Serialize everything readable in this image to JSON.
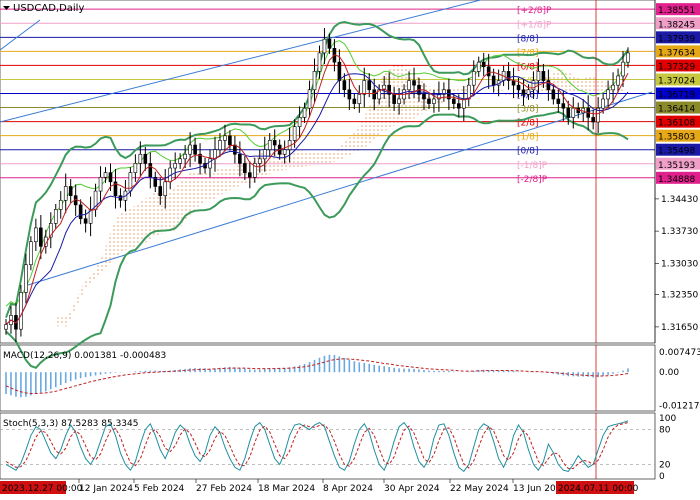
{
  "chart_data": {
    "type": "candlestick",
    "title": "USDCAD,Daily",
    "price_axis": {
      "ticks": [
        "1.34430",
        "1.33730",
        "1.33030",
        "1.32350",
        "1.31650"
      ],
      "ylim": [
        1.313,
        1.3875
      ]
    },
    "date_axis": {
      "ticks": [
        "12 Jan 2024",
        "5 Feb 2024",
        "27 Feb 2024",
        "18 Mar 2024",
        "8 Apr 2024",
        "30 Apr 2024",
        "22 May 2024",
        "13 Jun 20"
      ],
      "start_label": "2023.12.27 00:00",
      "cursor_label": "2024.07.11 00:00"
    },
    "price_levels": [
      {
        "price": "1.38551",
        "value": 1.38551,
        "label": "[+2/8]P",
        "color": "#e0208c"
      },
      {
        "price": "1.38245",
        "value": 1.38245,
        "label": "[+1/8]P",
        "color": "#f0a0c8"
      },
      {
        "price": "1.37939",
        "value": 1.37939,
        "label": "[8/8]",
        "color": "#1a1aa6"
      },
      {
        "price": "1.37634",
        "value": 1.37634,
        "label": "[7/8]",
        "color": "#e6a817"
      },
      {
        "price": "1.37329",
        "value": 1.37329,
        "label": "[6/8]",
        "color": "#e00000"
      },
      {
        "price": "1.37024",
        "value": 1.37024,
        "label": "[5/8]",
        "color": "#c8c840"
      },
      {
        "price": "1.36719",
        "value": 1.36719,
        "label": "[4/8]",
        "color": "#0000c8"
      },
      {
        "price": "1.36414",
        "value": 1.36414,
        "label": "[3/8]",
        "color": "#8a8a2a"
      },
      {
        "price": "1.36108",
        "value": 1.36108,
        "label": "[2/8]",
        "color": "#e00000"
      },
      {
        "price": "1.35803",
        "value": 1.35803,
        "label": "[1/8]",
        "color": "#e6a817"
      },
      {
        "price": "1.35498",
        "value": 1.35498,
        "label": "[0/8]",
        "color": "#1a1aa6"
      },
      {
        "price": "1.35193",
        "value": 1.35193,
        "label": "[-1/8]P",
        "color": "#f0a0c8"
      },
      {
        "price": "1.34888",
        "value": 1.34888,
        "label": "[-2/8]P",
        "color": "#e0208c"
      }
    ],
    "close": [
      1.317,
      1.319,
      1.316,
      1.324,
      1.33,
      1.335,
      1.338,
      1.334,
      1.336,
      1.339,
      1.342,
      1.344,
      1.347,
      1.345,
      1.343,
      1.34,
      1.339,
      1.342,
      1.346,
      1.349,
      1.35,
      1.348,
      1.345,
      1.344,
      1.346,
      1.35,
      1.352,
      1.354,
      1.352,
      1.349,
      1.347,
      1.345,
      1.348,
      1.351,
      1.352,
      1.353,
      1.354,
      1.356,
      1.354,
      1.352,
      1.351,
      1.353,
      1.355,
      1.357,
      1.358,
      1.356,
      1.354,
      1.352,
      1.35,
      1.349,
      1.352,
      1.353,
      1.355,
      1.357,
      1.356,
      1.354,
      1.355,
      1.357,
      1.36,
      1.362,
      1.364,
      1.368,
      1.372,
      1.376,
      1.379,
      1.377,
      1.374,
      1.37,
      1.368,
      1.366,
      1.365,
      1.367,
      1.37,
      1.368,
      1.366,
      1.368,
      1.369,
      1.367,
      1.365,
      1.366,
      1.368,
      1.37,
      1.369,
      1.367,
      1.366,
      1.365,
      1.366,
      1.367,
      1.368,
      1.366,
      1.365,
      1.364,
      1.366,
      1.369,
      1.372,
      1.374,
      1.373,
      1.371,
      1.369,
      1.37,
      1.372,
      1.37,
      1.369,
      1.368,
      1.367,
      1.368,
      1.37,
      1.372,
      1.37,
      1.368,
      1.366,
      1.365,
      1.364,
      1.362,
      1.364,
      1.363,
      1.364,
      1.362,
      1.361,
      1.364,
      1.366,
      1.368,
      1.369,
      1.371,
      1.374,
      1.376
    ],
    "indicators": {
      "macd": {
        "label": "MACD(12,26,9) 0.001381 -0.000483",
        "ticks": [
          "0.007473",
          "0.00",
          "-0.012179"
        ],
        "ylim": [
          -0.0135,
          0.0085
        ],
        "histogram": [
          -0.008,
          -0.0085,
          -0.009,
          -0.0092,
          -0.009,
          -0.0085,
          -0.008,
          -0.0075,
          -0.007,
          -0.0063,
          -0.0055,
          -0.0047,
          -0.004,
          -0.0033,
          -0.0027,
          -0.0022,
          -0.0018,
          -0.0015,
          -0.0012,
          -0.0009,
          -0.0006,
          -0.0004,
          -0.0002,
          -0.0001,
          0.0,
          0.0001,
          0.0003,
          0.0004,
          0.0005,
          0.0006,
          0.0006,
          0.0005,
          0.0005,
          0.0006,
          0.0008,
          0.001,
          0.0012,
          0.0014,
          0.0015,
          0.0015,
          0.0014,
          0.0013,
          0.0014,
          0.0016,
          0.0018,
          0.0019,
          0.0018,
          0.0016,
          0.0013,
          0.001,
          0.0009,
          0.001,
          0.0012,
          0.0014,
          0.0015,
          0.0015,
          0.0016,
          0.0018,
          0.0021,
          0.0025,
          0.003,
          0.0037,
          0.0045,
          0.0053,
          0.006,
          0.0064,
          0.0063,
          0.0058,
          0.0052,
          0.0046,
          0.004,
          0.0036,
          0.0034,
          0.0031,
          0.0027,
          0.0024,
          0.0022,
          0.0019,
          0.0016,
          0.0014,
          0.0013,
          0.0013,
          0.0012,
          0.001,
          0.0008,
          0.0006,
          0.0005,
          0.0005,
          0.0005,
          0.0004,
          0.0002,
          0.0,
          0.0,
          0.0002,
          0.0005,
          0.0008,
          0.0009,
          0.0008,
          0.0006,
          0.0006,
          0.0007,
          0.0006,
          0.0004,
          0.0002,
          0.0,
          -0.0001,
          -0.0001,
          0.0,
          -0.0001,
          -0.0003,
          -0.0006,
          -0.0009,
          -0.0012,
          -0.0015,
          -0.0015,
          -0.0016,
          -0.0016,
          -0.0017,
          -0.0019,
          -0.0018,
          -0.0014,
          -0.001,
          -0.0006,
          -0.0002,
          0.0006,
          0.0014
        ],
        "signal": [
          -0.005,
          -0.0058,
          -0.0066,
          -0.0072,
          -0.0076,
          -0.0078,
          -0.0078,
          -0.0077,
          -0.0076,
          -0.0073,
          -0.007,
          -0.0065,
          -0.006,
          -0.0055,
          -0.005,
          -0.0045,
          -0.004,
          -0.0035,
          -0.0031,
          -0.0027,
          -0.0023,
          -0.0019,
          -0.0016,
          -0.0013,
          -0.001,
          -0.0008,
          -0.0006,
          -0.0004,
          -0.0002,
          -0.0001,
          0.0,
          0.0001,
          0.0002,
          0.0003,
          0.0004,
          0.0005,
          0.0006,
          0.0008,
          0.0009,
          0.001,
          0.0011,
          0.0011,
          0.0012,
          0.0013,
          0.0014,
          0.0015,
          0.0015,
          0.0015,
          0.0015,
          0.0014,
          0.0013,
          0.0013,
          0.0013,
          0.0013,
          0.0013,
          0.0014,
          0.0014,
          0.0015,
          0.0016,
          0.0018,
          0.002,
          0.0023,
          0.0027,
          0.0032,
          0.0037,
          0.0042,
          0.0046,
          0.0048,
          0.0049,
          0.0048,
          0.0047,
          0.0045,
          0.0043,
          0.0041,
          0.0038,
          0.0035,
          0.0032,
          0.003,
          0.0027,
          0.0024,
          0.0022,
          0.002,
          0.0018,
          0.0016,
          0.0014,
          0.0012,
          0.0011,
          0.001,
          0.0009,
          0.0008,
          0.0007,
          0.0005,
          0.0004,
          0.0004,
          0.0004,
          0.0005,
          0.0005,
          0.0006,
          0.0006,
          0.0006,
          0.0006,
          0.0006,
          0.0005,
          0.0005,
          0.0004,
          0.0003,
          0.0002,
          0.0002,
          0.0001,
          0.0,
          -0.0001,
          -0.0003,
          -0.0005,
          -0.0007,
          -0.0009,
          -0.001,
          -0.0011,
          -0.0012,
          -0.0013,
          -0.0014,
          -0.0014,
          -0.0013,
          -0.0012,
          -0.001,
          -0.0008,
          -0.0005
        ]
      },
      "stochastic": {
        "label": "Stoch(5,3,3) 87.5283 85.3345",
        "ticks": [
          "100",
          "80",
          "20",
          "0"
        ],
        "ylim": [
          0,
          100
        ],
        "levels": [
          80,
          20
        ],
        "main": [
          20,
          15,
          10,
          22,
          45,
          70,
          85,
          80,
          60,
          40,
          30,
          45,
          70,
          88,
          75,
          50,
          30,
          20,
          35,
          60,
          85,
          90,
          70,
          40,
          20,
          10,
          25,
          55,
          80,
          90,
          70,
          45,
          30,
          50,
          75,
          88,
          80,
          55,
          35,
          25,
          40,
          70,
          85,
          75,
          50,
          30,
          15,
          10,
          30,
          60,
          85,
          92,
          80,
          55,
          30,
          20,
          40,
          70,
          88,
          90,
          85,
          80,
          88,
          92,
          85,
          60,
          35,
          15,
          10,
          25,
          55,
          80,
          90,
          75,
          45,
          20,
          10,
          30,
          60,
          85,
          92,
          80,
          50,
          25,
          15,
          30,
          65,
          88,
          90,
          70,
          40,
          15,
          8,
          20,
          50,
          80,
          90,
          85,
          60,
          30,
          15,
          35,
          70,
          88,
          75,
          45,
          20,
          10,
          25,
          55,
          40,
          20,
          10,
          8,
          20,
          35,
          25,
          15,
          20,
          45,
          70,
          85,
          88,
          90,
          92,
          95
        ],
        "signal": [
          25,
          20,
          15,
          16,
          26,
          46,
          67,
          78,
          75,
          60,
          43,
          38,
          48,
          68,
          78,
          71,
          52,
          33,
          28,
          38,
          60,
          78,
          82,
          67,
          43,
          23,
          18,
          30,
          53,
          75,
          80,
          68,
          48,
          42,
          52,
          71,
          81,
          74,
          57,
          38,
          33,
          45,
          65,
          77,
          70,
          52,
          32,
          18,
          18,
          33,
          58,
          79,
          86,
          76,
          55,
          35,
          30,
          43,
          66,
          83,
          88,
          85,
          84,
          87,
          88,
          79,
          60,
          37,
          20,
          17,
          30,
          53,
          75,
          82,
          70,
          47,
          25,
          20,
          33,
          58,
          79,
          86,
          74,
          52,
          30,
          23,
          37,
          61,
          81,
          83,
          67,
          42,
          21,
          14,
          26,
          50,
          73,
          85,
          78,
          58,
          35,
          27,
          40,
          64,
          78,
          69,
          47,
          25,
          18,
          30,
          40,
          38,
          23,
          13,
          13,
          21,
          27,
          25,
          20,
          27,
          45,
          67,
          81,
          88,
          90,
          92
        ]
      }
    }
  }
}
